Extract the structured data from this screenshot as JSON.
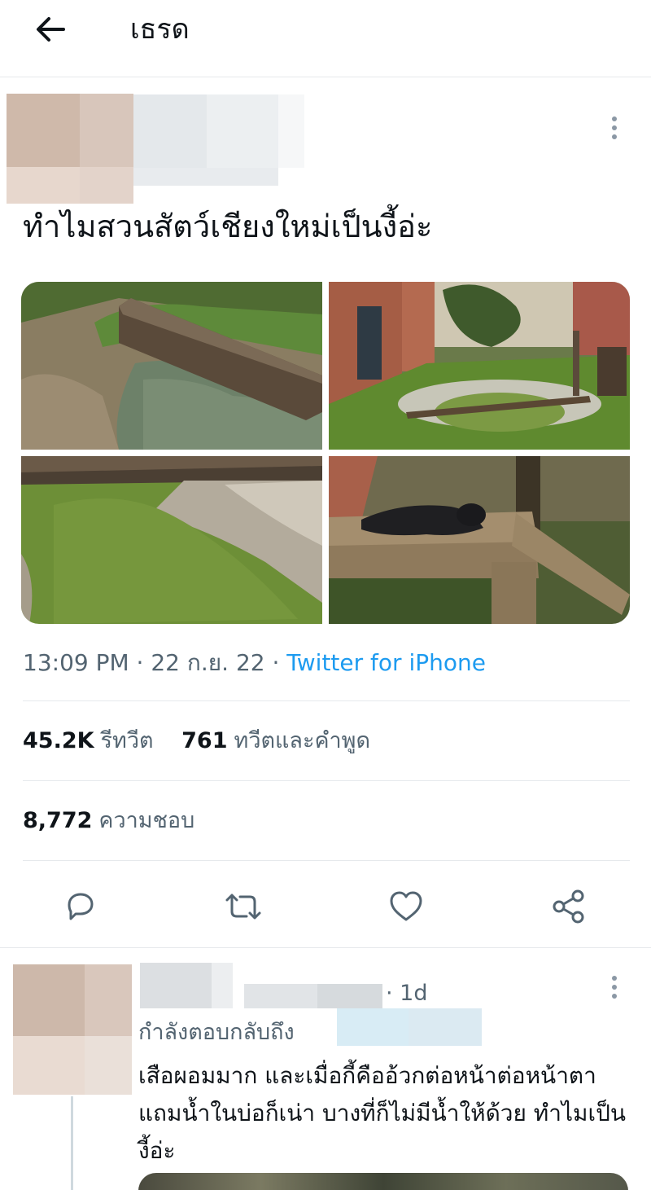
{
  "header": {
    "title": "เธรด"
  },
  "tweet": {
    "text": "ทำไมสวนสัตว์เชียงใหม่เป็นงี้อ่ะ",
    "photos": [
      "Murky pond with fallen log",
      "Enclosure with dirty pool and log",
      "Green stagnant water by concrete bank",
      "Black panther lying on wooden platform"
    ],
    "time": "13:09 PM",
    "date": "22 ก.ย. 22",
    "separator": "·",
    "source": "Twitter for iPhone",
    "retweets_count": "45.2K",
    "retweets_label": "รีทวีต",
    "quotes_count": "761",
    "quotes_label": "ทวีตและคำพูด",
    "likes_count": "8,772",
    "likes_label": "ความชอบ",
    "actions": [
      "reply-icon",
      "retweet-icon",
      "like-icon",
      "share-icon"
    ]
  },
  "reply": {
    "time": "· 1d",
    "replying_label": "กำลังตอบกลับถึง",
    "text": "เสือผอมมาก และเมื่อกี้คืออ้วกต่อหน้าต่อหน้าตา แถมน้ำในบ่อก็เน่า บางที่ก็ไม่มีน้ำให้ด้วย ทำไมเป็นงี้อ่ะ"
  },
  "colors": {
    "text_primary": "#0f1419",
    "text_secondary": "#536471",
    "link": "#1d9bf0",
    "divider": "#e6e9ec"
  }
}
